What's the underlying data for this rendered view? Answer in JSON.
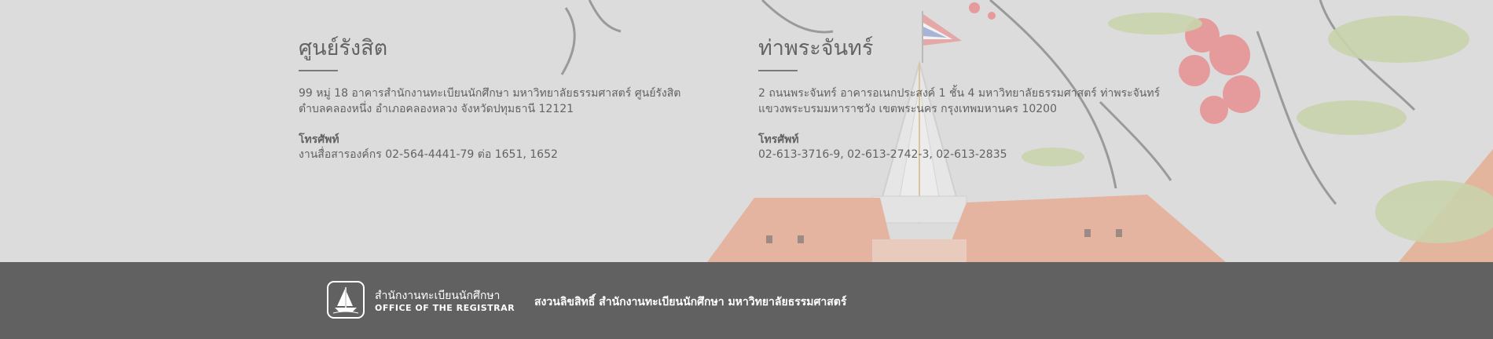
{
  "campuses": {
    "rangsit": {
      "title": "ศูนย์รังสิต",
      "address_line1": "99 หมู่ 18 อาคารสำนักงานทะเบียนนักศึกษา มหาวิทยาลัยธรรมศาสตร์ ศูนย์รังสิต",
      "address_line2": "ตำบลคลองหนึ่ง อำเภอคลองหลวง จังหวัดปทุมธานี  12121",
      "phone_label": "โทรศัพท์",
      "phone": "งานสื่อสารองค์กร  02-564-4441-79 ต่อ 1651, 1652"
    },
    "tha_prachan": {
      "title": "ท่าพระจันทร์",
      "address_line1": "2 ถนนพระจันทร์ อาคารอเนกประสงค์ 1 ชั้น 4 มหาวิทยาลัยธรรมศาสตร์ ท่าพระจันทร์",
      "address_line2": "แขวงพระบรมมหาราชวัง เขตพระนคร กรุงเทพมหานคร 10200",
      "phone_label": "โทรศัพท์",
      "phone": "02-613-3716-9, 02-613-2742-3, 02-613-2835"
    }
  },
  "footer": {
    "logo_icon": "registrar-ship-logo-icon",
    "org_name_th": "สำนักงานทะเบียนนักศึกษา",
    "org_name_en": "OFFICE OF THE REGISTRAR",
    "copyright": "สงวนลิขสิทธิ์ สำนักงานทะเบียนนักศึกษา มหาวิทยาลัยธรรมศาสตร์"
  },
  "colors": {
    "footer_bg": "#616161",
    "heading": "#646464",
    "body_text": "#626262",
    "footer_text": "#ffffff"
  }
}
